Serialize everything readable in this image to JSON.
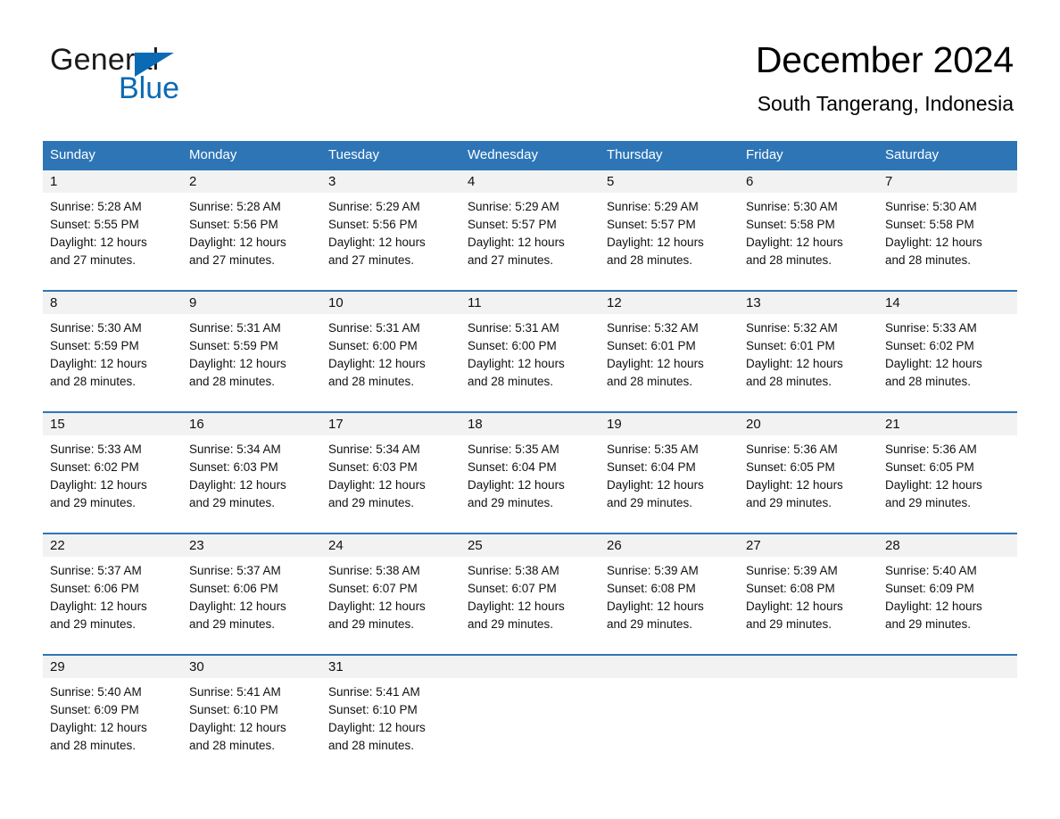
{
  "logo": {
    "word_one": "General",
    "word_two": "Blue",
    "triangle_color": "#0a6ab4",
    "blue_text_color": "#0a6ab4",
    "icon": "general-blue-logo"
  },
  "header": {
    "title": "December 2024",
    "subtitle": "South Tangerang, Indonesia"
  },
  "theme": {
    "header_blue": "#2e75b6",
    "row_rule_blue": "#2e75b6",
    "daynum_band_gray": "#f2f2f2",
    "text_black": "#111111"
  },
  "weekdays": [
    "Sunday",
    "Monday",
    "Tuesday",
    "Wednesday",
    "Thursday",
    "Friday",
    "Saturday"
  ],
  "weeks": [
    {
      "days": [
        {
          "num": "1",
          "sunrise": "Sunrise: 5:28 AM",
          "sunset": "Sunset: 5:55 PM",
          "daylight1": "Daylight: 12 hours",
          "daylight2": "and 27 minutes."
        },
        {
          "num": "2",
          "sunrise": "Sunrise: 5:28 AM",
          "sunset": "Sunset: 5:56 PM",
          "daylight1": "Daylight: 12 hours",
          "daylight2": "and 27 minutes."
        },
        {
          "num": "3",
          "sunrise": "Sunrise: 5:29 AM",
          "sunset": "Sunset: 5:56 PM",
          "daylight1": "Daylight: 12 hours",
          "daylight2": "and 27 minutes."
        },
        {
          "num": "4",
          "sunrise": "Sunrise: 5:29 AM",
          "sunset": "Sunset: 5:57 PM",
          "daylight1": "Daylight: 12 hours",
          "daylight2": "and 27 minutes."
        },
        {
          "num": "5",
          "sunrise": "Sunrise: 5:29 AM",
          "sunset": "Sunset: 5:57 PM",
          "daylight1": "Daylight: 12 hours",
          "daylight2": "and 28 minutes."
        },
        {
          "num": "6",
          "sunrise": "Sunrise: 5:30 AM",
          "sunset": "Sunset: 5:58 PM",
          "daylight1": "Daylight: 12 hours",
          "daylight2": "and 28 minutes."
        },
        {
          "num": "7",
          "sunrise": "Sunrise: 5:30 AM",
          "sunset": "Sunset: 5:58 PM",
          "daylight1": "Daylight: 12 hours",
          "daylight2": "and 28 minutes."
        }
      ]
    },
    {
      "days": [
        {
          "num": "8",
          "sunrise": "Sunrise: 5:30 AM",
          "sunset": "Sunset: 5:59 PM",
          "daylight1": "Daylight: 12 hours",
          "daylight2": "and 28 minutes."
        },
        {
          "num": "9",
          "sunrise": "Sunrise: 5:31 AM",
          "sunset": "Sunset: 5:59 PM",
          "daylight1": "Daylight: 12 hours",
          "daylight2": "and 28 minutes."
        },
        {
          "num": "10",
          "sunrise": "Sunrise: 5:31 AM",
          "sunset": "Sunset: 6:00 PM",
          "daylight1": "Daylight: 12 hours",
          "daylight2": "and 28 minutes."
        },
        {
          "num": "11",
          "sunrise": "Sunrise: 5:31 AM",
          "sunset": "Sunset: 6:00 PM",
          "daylight1": "Daylight: 12 hours",
          "daylight2": "and 28 minutes."
        },
        {
          "num": "12",
          "sunrise": "Sunrise: 5:32 AM",
          "sunset": "Sunset: 6:01 PM",
          "daylight1": "Daylight: 12 hours",
          "daylight2": "and 28 minutes."
        },
        {
          "num": "13",
          "sunrise": "Sunrise: 5:32 AM",
          "sunset": "Sunset: 6:01 PM",
          "daylight1": "Daylight: 12 hours",
          "daylight2": "and 28 minutes."
        },
        {
          "num": "14",
          "sunrise": "Sunrise: 5:33 AM",
          "sunset": "Sunset: 6:02 PM",
          "daylight1": "Daylight: 12 hours",
          "daylight2": "and 28 minutes."
        }
      ]
    },
    {
      "days": [
        {
          "num": "15",
          "sunrise": "Sunrise: 5:33 AM",
          "sunset": "Sunset: 6:02 PM",
          "daylight1": "Daylight: 12 hours",
          "daylight2": "and 29 minutes."
        },
        {
          "num": "16",
          "sunrise": "Sunrise: 5:34 AM",
          "sunset": "Sunset: 6:03 PM",
          "daylight1": "Daylight: 12 hours",
          "daylight2": "and 29 minutes."
        },
        {
          "num": "17",
          "sunrise": "Sunrise: 5:34 AM",
          "sunset": "Sunset: 6:03 PM",
          "daylight1": "Daylight: 12 hours",
          "daylight2": "and 29 minutes."
        },
        {
          "num": "18",
          "sunrise": "Sunrise: 5:35 AM",
          "sunset": "Sunset: 6:04 PM",
          "daylight1": "Daylight: 12 hours",
          "daylight2": "and 29 minutes."
        },
        {
          "num": "19",
          "sunrise": "Sunrise: 5:35 AM",
          "sunset": "Sunset: 6:04 PM",
          "daylight1": "Daylight: 12 hours",
          "daylight2": "and 29 minutes."
        },
        {
          "num": "20",
          "sunrise": "Sunrise: 5:36 AM",
          "sunset": "Sunset: 6:05 PM",
          "daylight1": "Daylight: 12 hours",
          "daylight2": "and 29 minutes."
        },
        {
          "num": "21",
          "sunrise": "Sunrise: 5:36 AM",
          "sunset": "Sunset: 6:05 PM",
          "daylight1": "Daylight: 12 hours",
          "daylight2": "and 29 minutes."
        }
      ]
    },
    {
      "days": [
        {
          "num": "22",
          "sunrise": "Sunrise: 5:37 AM",
          "sunset": "Sunset: 6:06 PM",
          "daylight1": "Daylight: 12 hours",
          "daylight2": "and 29 minutes."
        },
        {
          "num": "23",
          "sunrise": "Sunrise: 5:37 AM",
          "sunset": "Sunset: 6:06 PM",
          "daylight1": "Daylight: 12 hours",
          "daylight2": "and 29 minutes."
        },
        {
          "num": "24",
          "sunrise": "Sunrise: 5:38 AM",
          "sunset": "Sunset: 6:07 PM",
          "daylight1": "Daylight: 12 hours",
          "daylight2": "and 29 minutes."
        },
        {
          "num": "25",
          "sunrise": "Sunrise: 5:38 AM",
          "sunset": "Sunset: 6:07 PM",
          "daylight1": "Daylight: 12 hours",
          "daylight2": "and 29 minutes."
        },
        {
          "num": "26",
          "sunrise": "Sunrise: 5:39 AM",
          "sunset": "Sunset: 6:08 PM",
          "daylight1": "Daylight: 12 hours",
          "daylight2": "and 29 minutes."
        },
        {
          "num": "27",
          "sunrise": "Sunrise: 5:39 AM",
          "sunset": "Sunset: 6:08 PM",
          "daylight1": "Daylight: 12 hours",
          "daylight2": "and 29 minutes."
        },
        {
          "num": "28",
          "sunrise": "Sunrise: 5:40 AM",
          "sunset": "Sunset: 6:09 PM",
          "daylight1": "Daylight: 12 hours",
          "daylight2": "and 29 minutes."
        }
      ]
    },
    {
      "days": [
        {
          "num": "29",
          "sunrise": "Sunrise: 5:40 AM",
          "sunset": "Sunset: 6:09 PM",
          "daylight1": "Daylight: 12 hours",
          "daylight2": "and 28 minutes."
        },
        {
          "num": "30",
          "sunrise": "Sunrise: 5:41 AM",
          "sunset": "Sunset: 6:10 PM",
          "daylight1": "Daylight: 12 hours",
          "daylight2": "and 28 minutes."
        },
        {
          "num": "31",
          "sunrise": "Sunrise: 5:41 AM",
          "sunset": "Sunset: 6:10 PM",
          "daylight1": "Daylight: 12 hours",
          "daylight2": "and 28 minutes."
        },
        {
          "num": "",
          "sunrise": "",
          "sunset": "",
          "daylight1": "",
          "daylight2": ""
        },
        {
          "num": "",
          "sunrise": "",
          "sunset": "",
          "daylight1": "",
          "daylight2": ""
        },
        {
          "num": "",
          "sunrise": "",
          "sunset": "",
          "daylight1": "",
          "daylight2": ""
        },
        {
          "num": "",
          "sunrise": "",
          "sunset": "",
          "daylight1": "",
          "daylight2": ""
        }
      ]
    }
  ]
}
